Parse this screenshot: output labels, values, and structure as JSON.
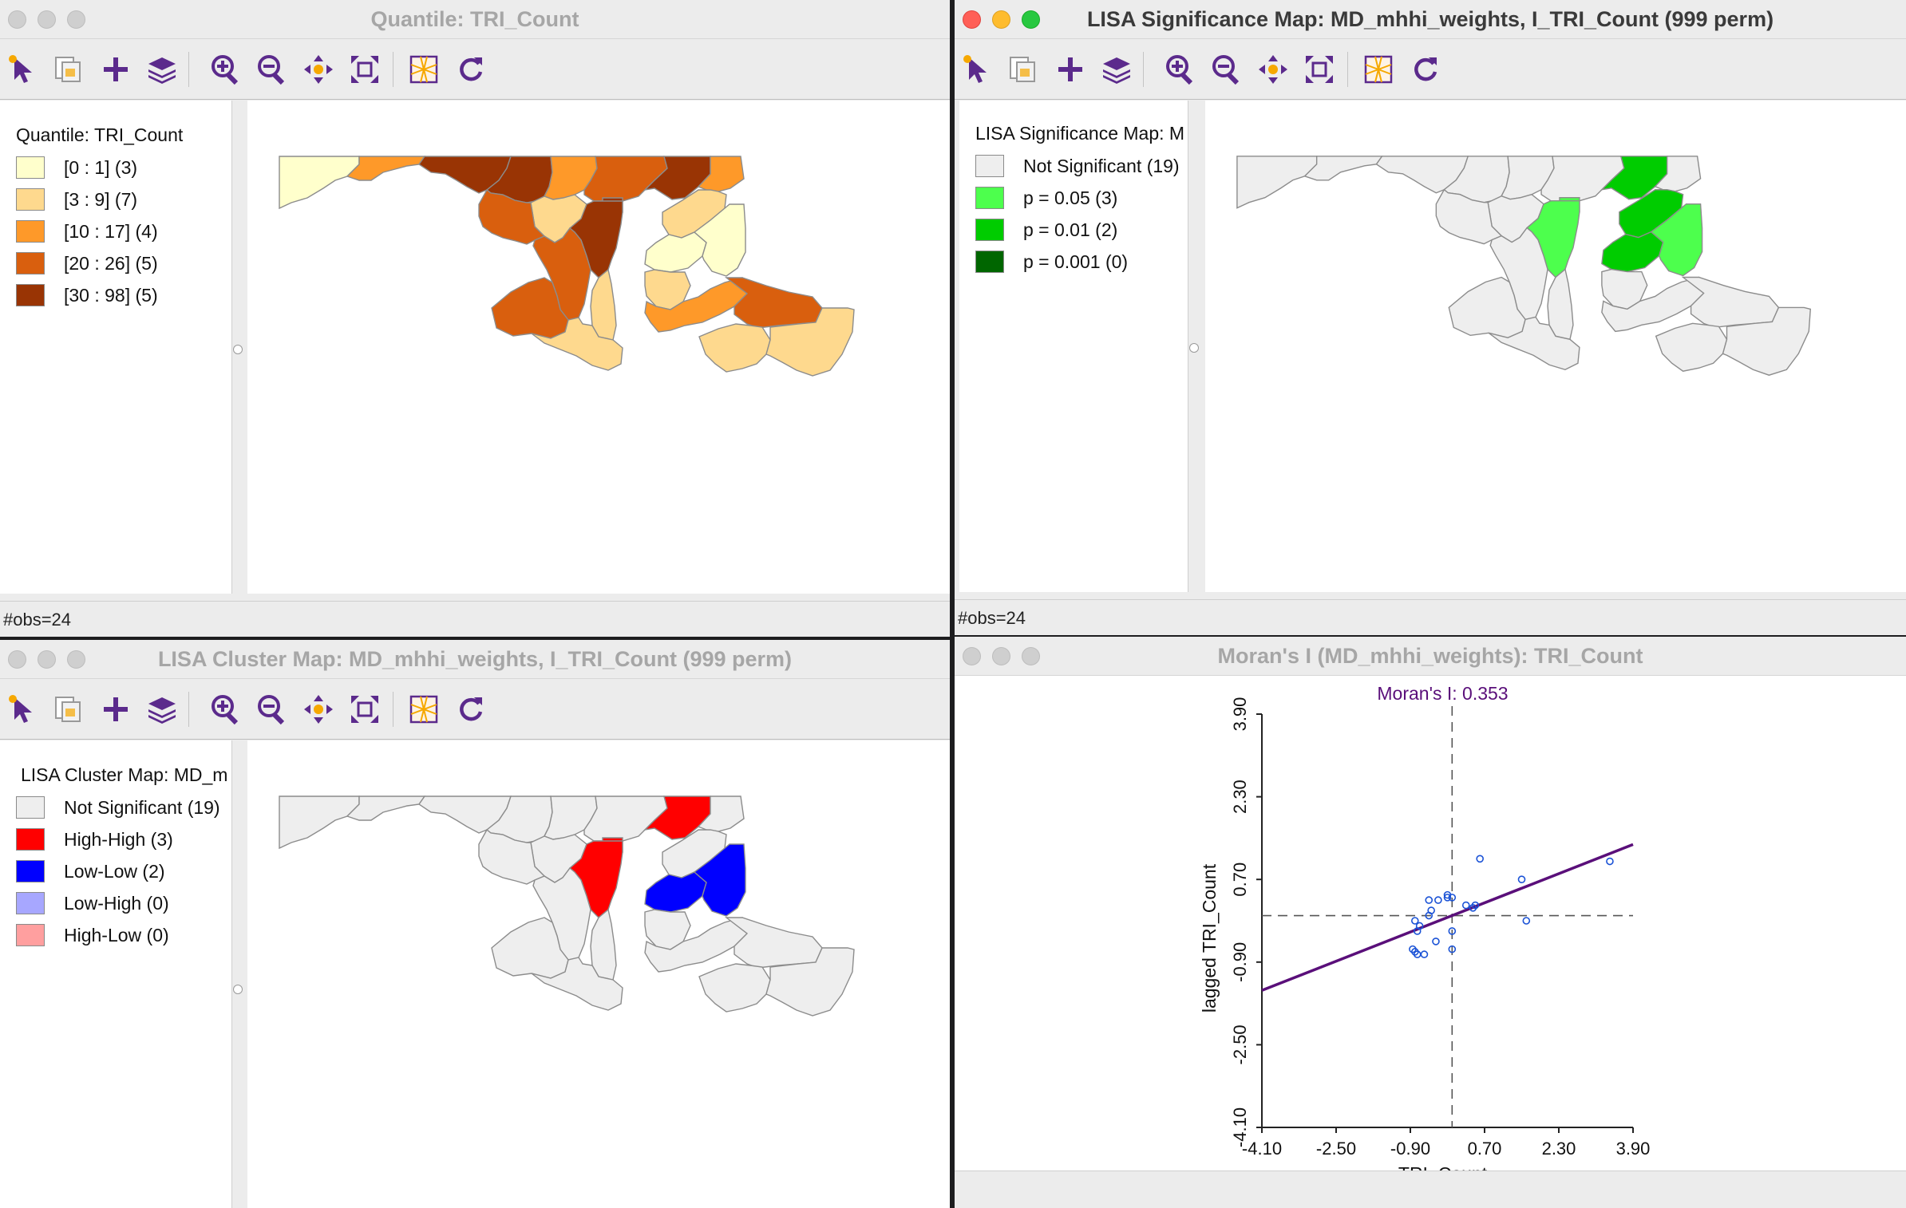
{
  "windows": {
    "quantile": {
      "title": "Quantile: TRI_Count",
      "legend_title": "Quantile: TRI_Count",
      "legend": [
        {
          "label": "[0 : 1] (3)",
          "color": "#ffffcc"
        },
        {
          "label": "[3 : 9] (7)",
          "color": "#fed98e"
        },
        {
          "label": "[10 : 17] (4)",
          "color": "#fe9929"
        },
        {
          "label": "[20 : 26] (5)",
          "color": "#d95f0e"
        },
        {
          "label": "[30 : 98] (5)",
          "color": "#993404"
        }
      ],
      "status": "#obs=24"
    },
    "significance": {
      "title": "LISA Significance Map: MD_mhhi_weights, I_TRI_Count (999 perm)",
      "legend_title": "LISA Significance Map: M",
      "legend": [
        {
          "label": "Not Significant (19)",
          "color": "#eeeeee"
        },
        {
          "label": "p = 0.05 (3)",
          "color": "#4dff4d"
        },
        {
          "label": "p = 0.01 (2)",
          "color": "#00cc00"
        },
        {
          "label": "p = 0.001 (0)",
          "color": "#006600"
        }
      ],
      "status": "#obs=24"
    },
    "cluster": {
      "title": "LISA Cluster Map: MD_mhhi_weights, I_TRI_Count (999 perm)",
      "legend_title": "LISA Cluster Map: MD_m",
      "legend": [
        {
          "label": "Not Significant (19)",
          "color": "#eeeeee"
        },
        {
          "label": "High-High (3)",
          "color": "#ff0000"
        },
        {
          "label": "Low-Low (2)",
          "color": "#0000ff"
        },
        {
          "label": "Low-High (0)",
          "color": "#a7a7ff"
        },
        {
          "label": "High-Low (0)",
          "color": "#ff9f9f"
        }
      ]
    },
    "moran": {
      "title": "Moran's I (MD_mhhi_weights): TRI_Count"
    }
  },
  "toolbar": {
    "icons": [
      "select-icon",
      "selection-map-icon",
      "add-icon",
      "layers-icon",
      "zoom-in-icon",
      "zoom-out-icon",
      "pan-icon",
      "full-extent-icon",
      "basemap-icon",
      "refresh-icon"
    ]
  },
  "chart_data": {
    "type": "scatter",
    "title": "Moran's I: 0.353",
    "xlabel": "TRI_Count",
    "ylabel": "lagged TRI_Count",
    "x_ticks": [
      "-4.10",
      "-2.50",
      "-0.90",
      "0.70",
      "2.30",
      "3.90"
    ],
    "y_ticks": [
      "-4.10",
      "-2.50",
      "-0.90",
      "0.70",
      "2.30",
      "3.90"
    ],
    "xlim": [
      -4.1,
      3.9
    ],
    "ylim": [
      -4.1,
      3.9
    ],
    "slope": 0.353,
    "points": [
      {
        "x": 0.6,
        "y": 1.1
      },
      {
        "x": 1.5,
        "y": 0.7
      },
      {
        "x": 3.4,
        "y": 1.05
      },
      {
        "x": 1.6,
        "y": -0.1
      },
      {
        "x": 0.5,
        "y": 0.2
      },
      {
        "x": 0.45,
        "y": 0.15
      },
      {
        "x": 0.0,
        "y": 0.35
      },
      {
        "x": -0.1,
        "y": 0.4
      },
      {
        "x": -0.3,
        "y": 0.3
      },
      {
        "x": -0.5,
        "y": 0.3
      },
      {
        "x": -0.5,
        "y": 0.0
      },
      {
        "x": -0.8,
        "y": -0.1
      },
      {
        "x": -0.75,
        "y": -0.3
      },
      {
        "x": -0.7,
        "y": -0.2
      },
      {
        "x": -0.35,
        "y": -0.5
      },
      {
        "x": 0.0,
        "y": -0.3
      },
      {
        "x": 0.0,
        "y": -0.65
      },
      {
        "x": -0.85,
        "y": -0.65
      },
      {
        "x": -0.75,
        "y": -0.75
      },
      {
        "x": -0.8,
        "y": -0.7
      },
      {
        "x": -0.1,
        "y": 0.35
      },
      {
        "x": 0.3,
        "y": 0.2
      },
      {
        "x": -0.45,
        "y": 0.1
      },
      {
        "x": -0.6,
        "y": -0.75
      }
    ]
  }
}
